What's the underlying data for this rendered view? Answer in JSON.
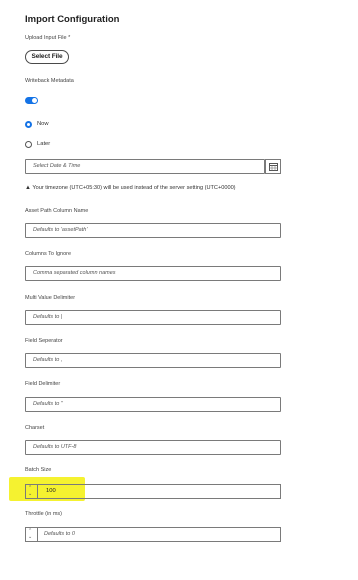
{
  "title": "Import Configuration",
  "upload": {
    "label": "Upload Input File *",
    "button": "Select File"
  },
  "writeback": {
    "label": "Writeback Metadata",
    "enabled": true
  },
  "schedule": {
    "now": "Now",
    "later": "Later",
    "selected": "Now",
    "date_placeholder": "Select Date & Time"
  },
  "timezone_note": "Your timezone (UTC+05:30) will be used instead of the server setting (UTC+0000)",
  "asset_path": {
    "label": "Asset Path Column Name",
    "placeholder": "Defaults to 'assetPath'"
  },
  "columns_ignore": {
    "label": "Columns To Ignore",
    "placeholder": "Comma separated column names"
  },
  "multi_value": {
    "label": "Multi Value Delimiter",
    "placeholder": "Defaults to |"
  },
  "field_separator": {
    "label": "Field Seperator",
    "placeholder": "Defaults to ,"
  },
  "field_delimiter": {
    "label": "Field Delimiter",
    "placeholder": "Defaults to \""
  },
  "charset": {
    "label": "Charset",
    "placeholder": "Defaults to UTF-8"
  },
  "batch_size": {
    "label": "Batch Size",
    "value": "100"
  },
  "throttle": {
    "label": "Throttle (in ms)",
    "placeholder": "Defaults to 0"
  },
  "colors": {
    "accent": "#1473e6",
    "highlight": "#f5f230"
  }
}
